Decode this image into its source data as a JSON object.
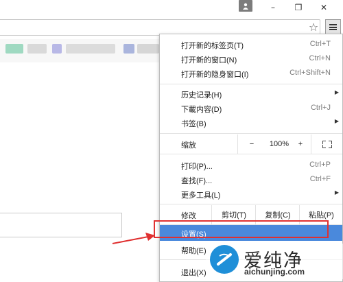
{
  "window": {
    "minimize_glyph": "–",
    "restore_glyph": "❐",
    "close_glyph": "✕"
  },
  "menu": {
    "items_top": [
      {
        "label": "打开新的标签页(T)",
        "shortcut": "Ctrl+T"
      },
      {
        "label": "打开新的窗口(N)",
        "shortcut": "Ctrl+N"
      },
      {
        "label": "打开新的隐身窗口(I)",
        "shortcut": "Ctrl+Shift+N"
      }
    ],
    "items_mid": [
      {
        "label": "历史记录(H)",
        "shortcut": "",
        "submenu": true
      },
      {
        "label": "下載内容(D)",
        "shortcut": "Ctrl+J"
      },
      {
        "label": "书签(B)",
        "shortcut": "",
        "submenu": true
      }
    ],
    "zoom": {
      "label": "缩放",
      "minus": "−",
      "value": "100%",
      "plus": "+"
    },
    "items_tools": [
      {
        "label": "打印(P)...",
        "shortcut": "Ctrl+P"
      },
      {
        "label": "查找(F)...",
        "shortcut": "Ctrl+F"
      },
      {
        "label": "更多工具(L)",
        "shortcut": "",
        "submenu": true
      }
    ],
    "edit": {
      "label": "修改",
      "cut": "剪切(T)",
      "copy": "复制(C)",
      "paste": "粘贴(P)"
    },
    "settings": "设置(S)",
    "help": "帮助(E)",
    "exit": "退出(X)"
  },
  "watermark": {
    "brand": "爱纯净",
    "url": "aichunjing.com"
  },
  "colors": {
    "highlight": "#4a89dc",
    "annotation_red": "#e03030",
    "watermark_blue": "#1f8fd8"
  }
}
